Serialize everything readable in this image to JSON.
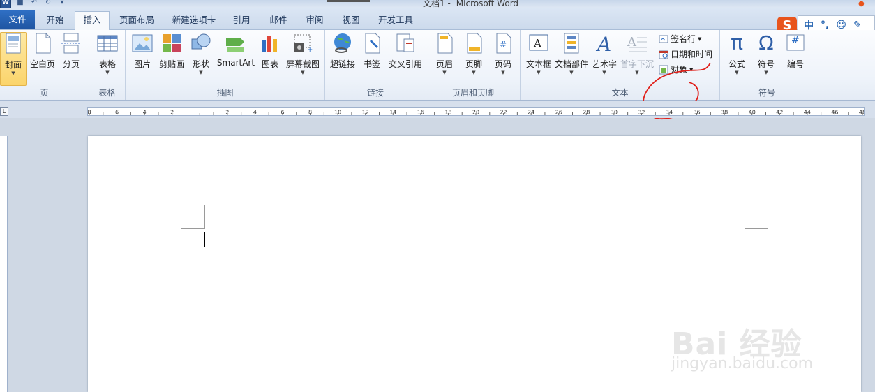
{
  "titlebar": {
    "doc_title": "文档1 -",
    "app_name": "Microsoft Word",
    "qat_logo": "W"
  },
  "tabs": [
    {
      "label": "文件"
    },
    {
      "label": "开始"
    },
    {
      "label": "插入"
    },
    {
      "label": "页面布局"
    },
    {
      "label": "新建选项卡"
    },
    {
      "label": "引用"
    },
    {
      "label": "邮件"
    },
    {
      "label": "审阅"
    },
    {
      "label": "视图"
    },
    {
      "label": "开发工具"
    }
  ],
  "ime": {
    "logo": "S",
    "lang": "中",
    "punct": "°,"
  },
  "ribbon": {
    "page_group": {
      "label": "页",
      "cover": "封面",
      "blank": "空白页",
      "break": "分页"
    },
    "table_group": {
      "label": "表格",
      "table": "表格"
    },
    "illustrations": {
      "label": "插图",
      "picture": "图片",
      "clipart": "剪贴画",
      "shapes": "形状",
      "smartart": "SmartArt",
      "chart": "图表",
      "screenshot": "屏幕截图"
    },
    "links": {
      "label": "链接",
      "hyperlink": "超链接",
      "bookmark": "书签",
      "crossref": "交叉引用"
    },
    "header_footer": {
      "label": "页眉和页脚",
      "header": "页眉",
      "footer": "页脚",
      "pagenum": "页码"
    },
    "text": {
      "label": "文本",
      "textbox": "文本框",
      "quickparts": "文档部件",
      "wordart": "艺术字",
      "dropcap": "首字下沉",
      "signature": "签名行",
      "datetime": "日期和时间",
      "object": "对象"
    },
    "symbols": {
      "label": "符号",
      "equation": "公式",
      "symbol": "符号",
      "number": "编号",
      "pi": "π",
      "omega": "Ω",
      "hash": "#"
    }
  },
  "ruler": {
    "labels": [
      "8",
      "6",
      "4",
      "2",
      "",
      "2",
      "4",
      "6",
      "8",
      "10",
      "12",
      "14",
      "16",
      "18",
      "20",
      "22",
      "24",
      "26",
      "28",
      "30",
      "32",
      "34",
      "36",
      "38",
      "40",
      "42",
      "44",
      "46",
      "48"
    ],
    "corner": "L"
  },
  "watermark": {
    "main": "Bai 经验",
    "sub": "jingyan.baidu.com"
  },
  "colors": {
    "file_tab": "#1f56a3",
    "annotation": "#e0201a",
    "sogou": "#e8541c"
  }
}
